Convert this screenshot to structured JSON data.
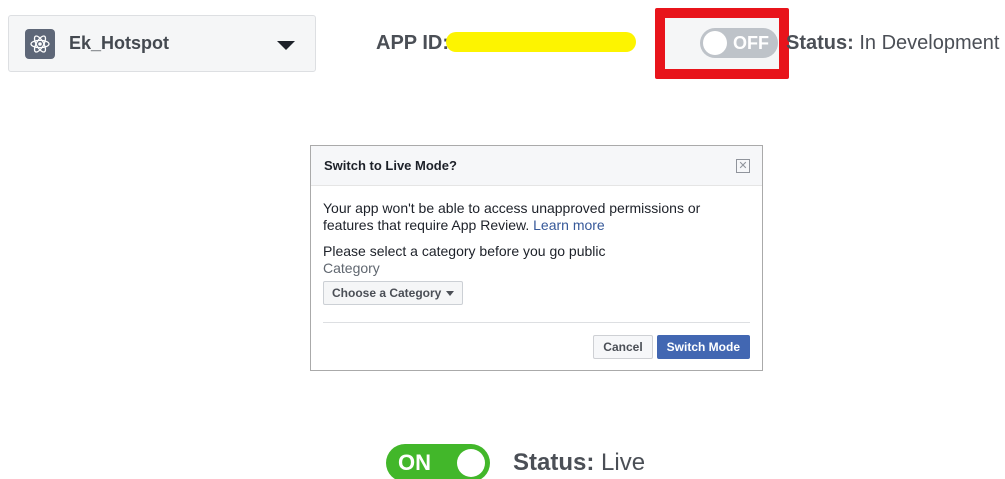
{
  "header": {
    "app_name": "Ek_Hotspot",
    "app_id_label": "APP ID:",
    "mode_toggle_text": "OFF",
    "status_label": "Status:",
    "status_value": "In Development"
  },
  "dialog": {
    "title": "Switch to Live Mode?",
    "message": "Your app won't be able to access unapproved permissions or features that require App Review.",
    "learn_more": "Learn more",
    "category_prompt": "Please select a category before you go public",
    "category_label": "Category",
    "category_select": "Choose a Category",
    "cancel_label": "Cancel",
    "confirm_label": "Switch Mode"
  },
  "result": {
    "mode_toggle_text": "ON",
    "status_label": "Status:",
    "status_value": "Live"
  },
  "colors": {
    "highlight": "#e8141b",
    "redaction": "#fdf400",
    "toggle_on": "#42b72a",
    "toggle_off": "#bec3c9",
    "primary_button": "#4267b2",
    "link": "#365899"
  },
  "icons": {
    "app": "atom-icon",
    "select_arrow": "caret-down-icon",
    "close": "close-icon"
  }
}
